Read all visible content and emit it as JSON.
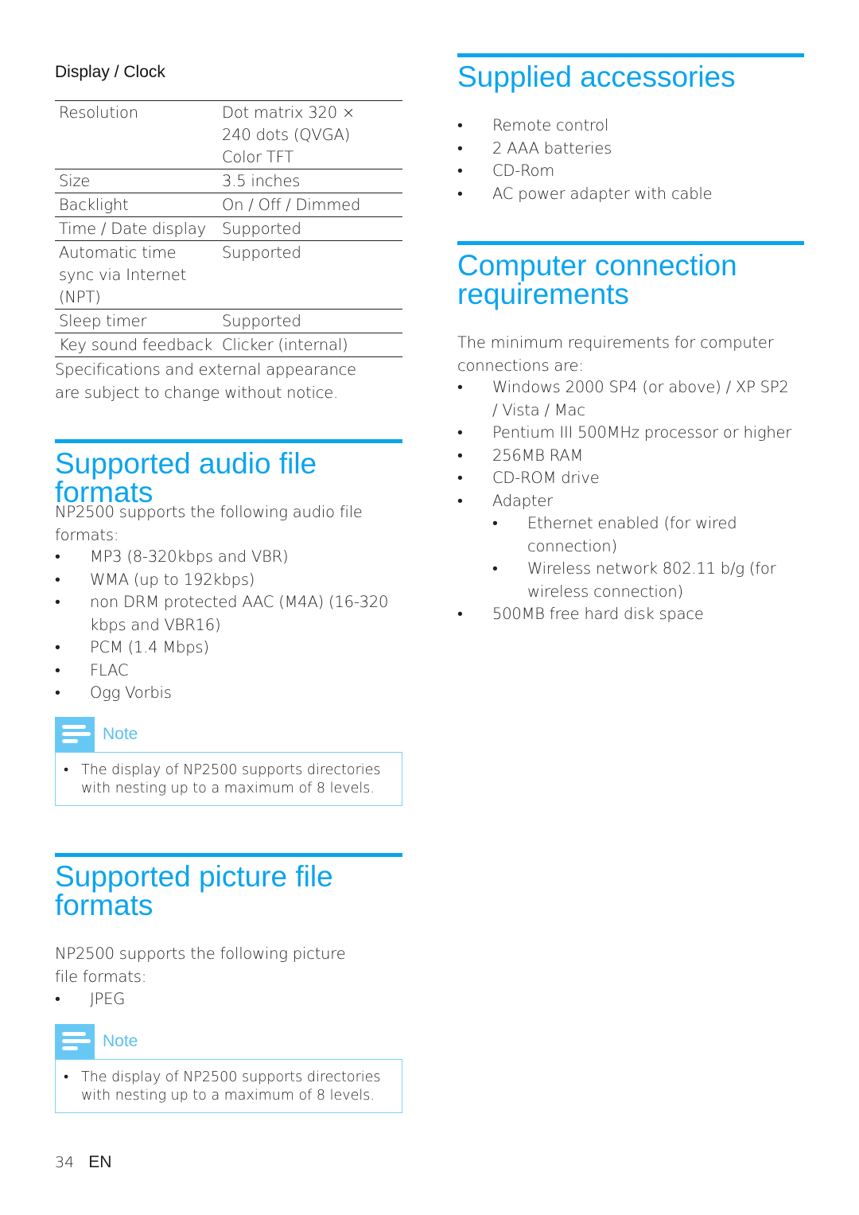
{
  "display_clock": {
    "subheading": "Display / Clock",
    "rows": [
      {
        "key": "Resolution",
        "value": "Dot matrix 320 × 240 dots (QVGA) Color TFT"
      },
      {
        "key": "Size",
        "value": "3.5 inches"
      },
      {
        "key": "Backlight",
        "value": "On / Off / Dimmed"
      },
      {
        "key": "Time / Date display",
        "value": "Supported"
      },
      {
        "key": "Automatic time sync via Internet (NPT)",
        "value": "Supported"
      },
      {
        "key": "Sleep timer",
        "value": "Supported"
      },
      {
        "key": "Key sound feedback",
        "value": "Clicker (internal)"
      }
    ],
    "disclaimer": "Specifications and external appearance are subject to change without notice."
  },
  "audio_formats": {
    "title": "Supported audio file formats",
    "intro": "NP2500 supports the following audio file formats:",
    "items": [
      "MP3 (8-320kbps and VBR)",
      "WMA (up to 192kbps)",
      "non DRM protected AAC (M4A) (16-320 kbps and VBR16)",
      "PCM (1.4 Mbps)",
      "FLAC",
      "Ogg Vorbis"
    ],
    "note": {
      "title": "Note",
      "text": "The display of NP2500 supports directories with nesting up to a maximum of 8 levels."
    }
  },
  "picture_formats": {
    "title": "Supported picture file formats",
    "intro": "NP2500 supports the following picture file formats:",
    "items": [
      "JPEG"
    ],
    "note": {
      "title": "Note",
      "text": "The display of NP2500 supports directories with nesting up to a maximum of 8 levels."
    }
  },
  "accessories": {
    "title": "Supplied accessories",
    "items": [
      "Remote control",
      "2 AAA batteries",
      "CD-Rom",
      "AC power adapter with cable"
    ]
  },
  "computer_requirements": {
    "title": "Computer connection requirements",
    "intro": "The minimum requirements for computer connections are:",
    "items": [
      "Windows 2000 SP4 (or above) / XP SP2 / Vista / Mac",
      "Pentium III 500MHz processor or higher",
      "256MB RAM",
      "CD-ROM drive",
      "Adapter",
      "500MB free hard disk space"
    ],
    "adapter_subitems": [
      "Ethernet enabled (for wired connection)",
      "Wireless network 802.11 b/g (for wireless connection)"
    ]
  },
  "footer": {
    "page_number": "34",
    "language": "EN"
  },
  "colors": {
    "heading_blue": "#0aa4ef",
    "note_blue": "#67c8f5"
  }
}
